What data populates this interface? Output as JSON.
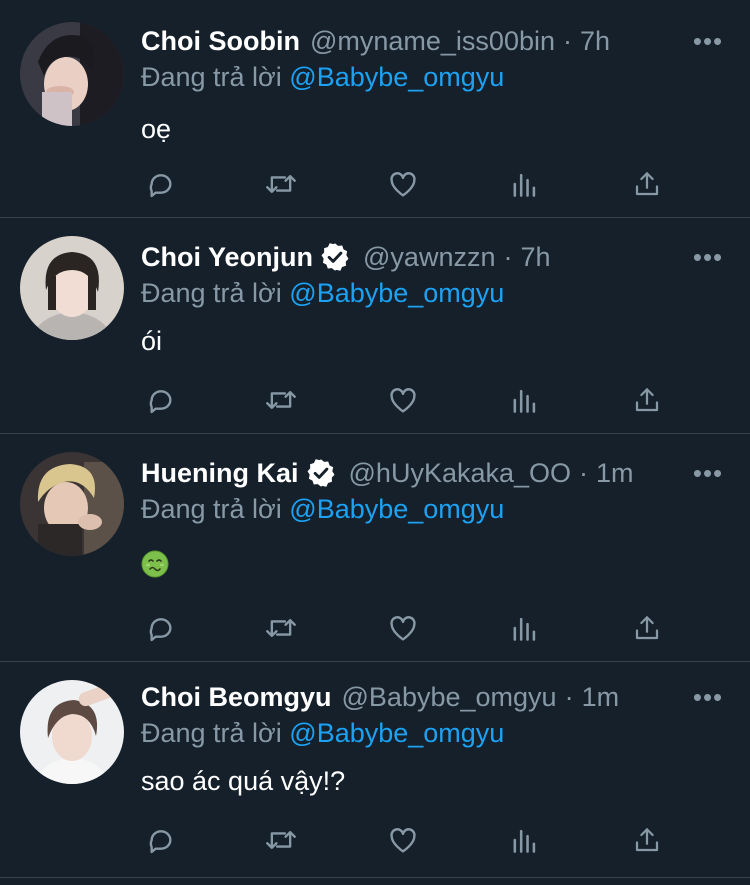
{
  "thread": {
    "tweets": [
      {
        "display_name": "Choi Soobin",
        "handle": "@myname_iss00bin",
        "separator": "·",
        "time": "7h",
        "verified": false,
        "reply_prefix": "Đang trả lời",
        "reply_to": "@Babybe_omgyu",
        "text": "oẹ",
        "avatar_colors": [
          "#2b2a30",
          "#e9cfc4",
          "#1b1a1f"
        ]
      },
      {
        "display_name": "Choi Yeonjun",
        "handle": "@yawnzzn",
        "separator": "·",
        "time": "7h",
        "verified": true,
        "reply_prefix": "Đang trả lời",
        "reply_to": "@Babybe_omgyu",
        "text": "ói",
        "avatar_colors": [
          "#d8d2cd",
          "#f1ddd4",
          "#2a2523"
        ]
      },
      {
        "display_name": "Huening Kai",
        "handle": "@hUyKakaka_OO",
        "separator": "·",
        "time": "1m",
        "verified": true,
        "reply_prefix": "Đang trả lời",
        "reply_to": "@Babybe_omgyu",
        "text": "",
        "emoji": "nauseated-face",
        "avatar_colors": [
          "#3a3534",
          "#e5c9b6",
          "#d9c58e"
        ]
      },
      {
        "display_name": "Choi Beomgyu",
        "handle": "@Babybe_omgyu",
        "separator": "·",
        "time": "1m",
        "verified": false,
        "reply_prefix": "Đang trả lời",
        "reply_to": "@Babybe_omgyu",
        "text": "sao ác quá vậy!?",
        "avatar_colors": [
          "#eef0f2",
          "#f0d9cf",
          "#5d4a42"
        ]
      }
    ]
  },
  "colors": {
    "background": "#15202b",
    "divider": "#38444d",
    "muted": "#8899a6",
    "link": "#1da1f2",
    "text": "#ffffff"
  },
  "icons": {
    "more": "more-horizontal-icon",
    "reply": "comment-icon",
    "retweet": "retweet-icon",
    "like": "heart-icon",
    "analytics": "analytics-icon",
    "share": "share-icon",
    "verified": "verified-badge-icon"
  }
}
